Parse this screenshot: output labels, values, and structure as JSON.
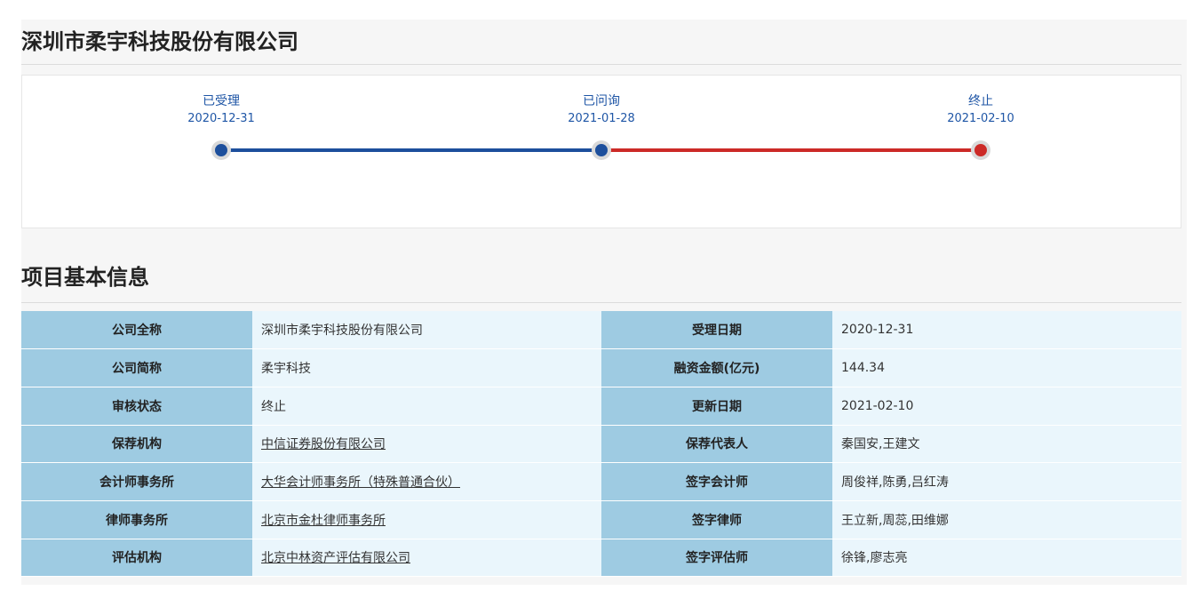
{
  "company_name": "深圳市柔宇科技股份有限公司",
  "timeline": {
    "steps": [
      {
        "label": "已受理",
        "date": "2020-12-31"
      },
      {
        "label": "已问询",
        "date": "2021-01-28"
      },
      {
        "label": "终止",
        "date": "2021-02-10"
      }
    ],
    "colors": {
      "completed": "#1d4f9c",
      "terminated": "#cc2a27"
    }
  },
  "section_title": "项目基本信息",
  "info": {
    "rows": [
      {
        "k1": "公司全称",
        "v1": "深圳市柔宇科技股份有限公司",
        "k2": "受理日期",
        "v2": "2020-12-31"
      },
      {
        "k1": "公司简称",
        "v1": "柔宇科技",
        "k2": "融资金额(亿元)",
        "v2": "144.34"
      },
      {
        "k1": "审核状态",
        "v1": "终止",
        "k2": "更新日期",
        "v2": "2021-02-10"
      },
      {
        "k1": "保荐机构",
        "v1": "中信证券股份有限公司",
        "k2": "保荐代表人",
        "v2": "秦国安,王建文"
      },
      {
        "k1": "会计师事务所",
        "v1": "大华会计师事务所（特殊普通合伙）",
        "k2": "签字会计师",
        "v2": "周俊祥,陈勇,吕红涛"
      },
      {
        "k1": "律师事务所",
        "v1": "北京市金杜律师事务所",
        "k2": "签字律师",
        "v2": "王立新,周蕊,田维娜"
      },
      {
        "k1": "评估机构",
        "v1": "北京中林资产评估有限公司",
        "k2": "签字评估师",
        "v2": "徐锋,廖志亮"
      }
    ]
  }
}
